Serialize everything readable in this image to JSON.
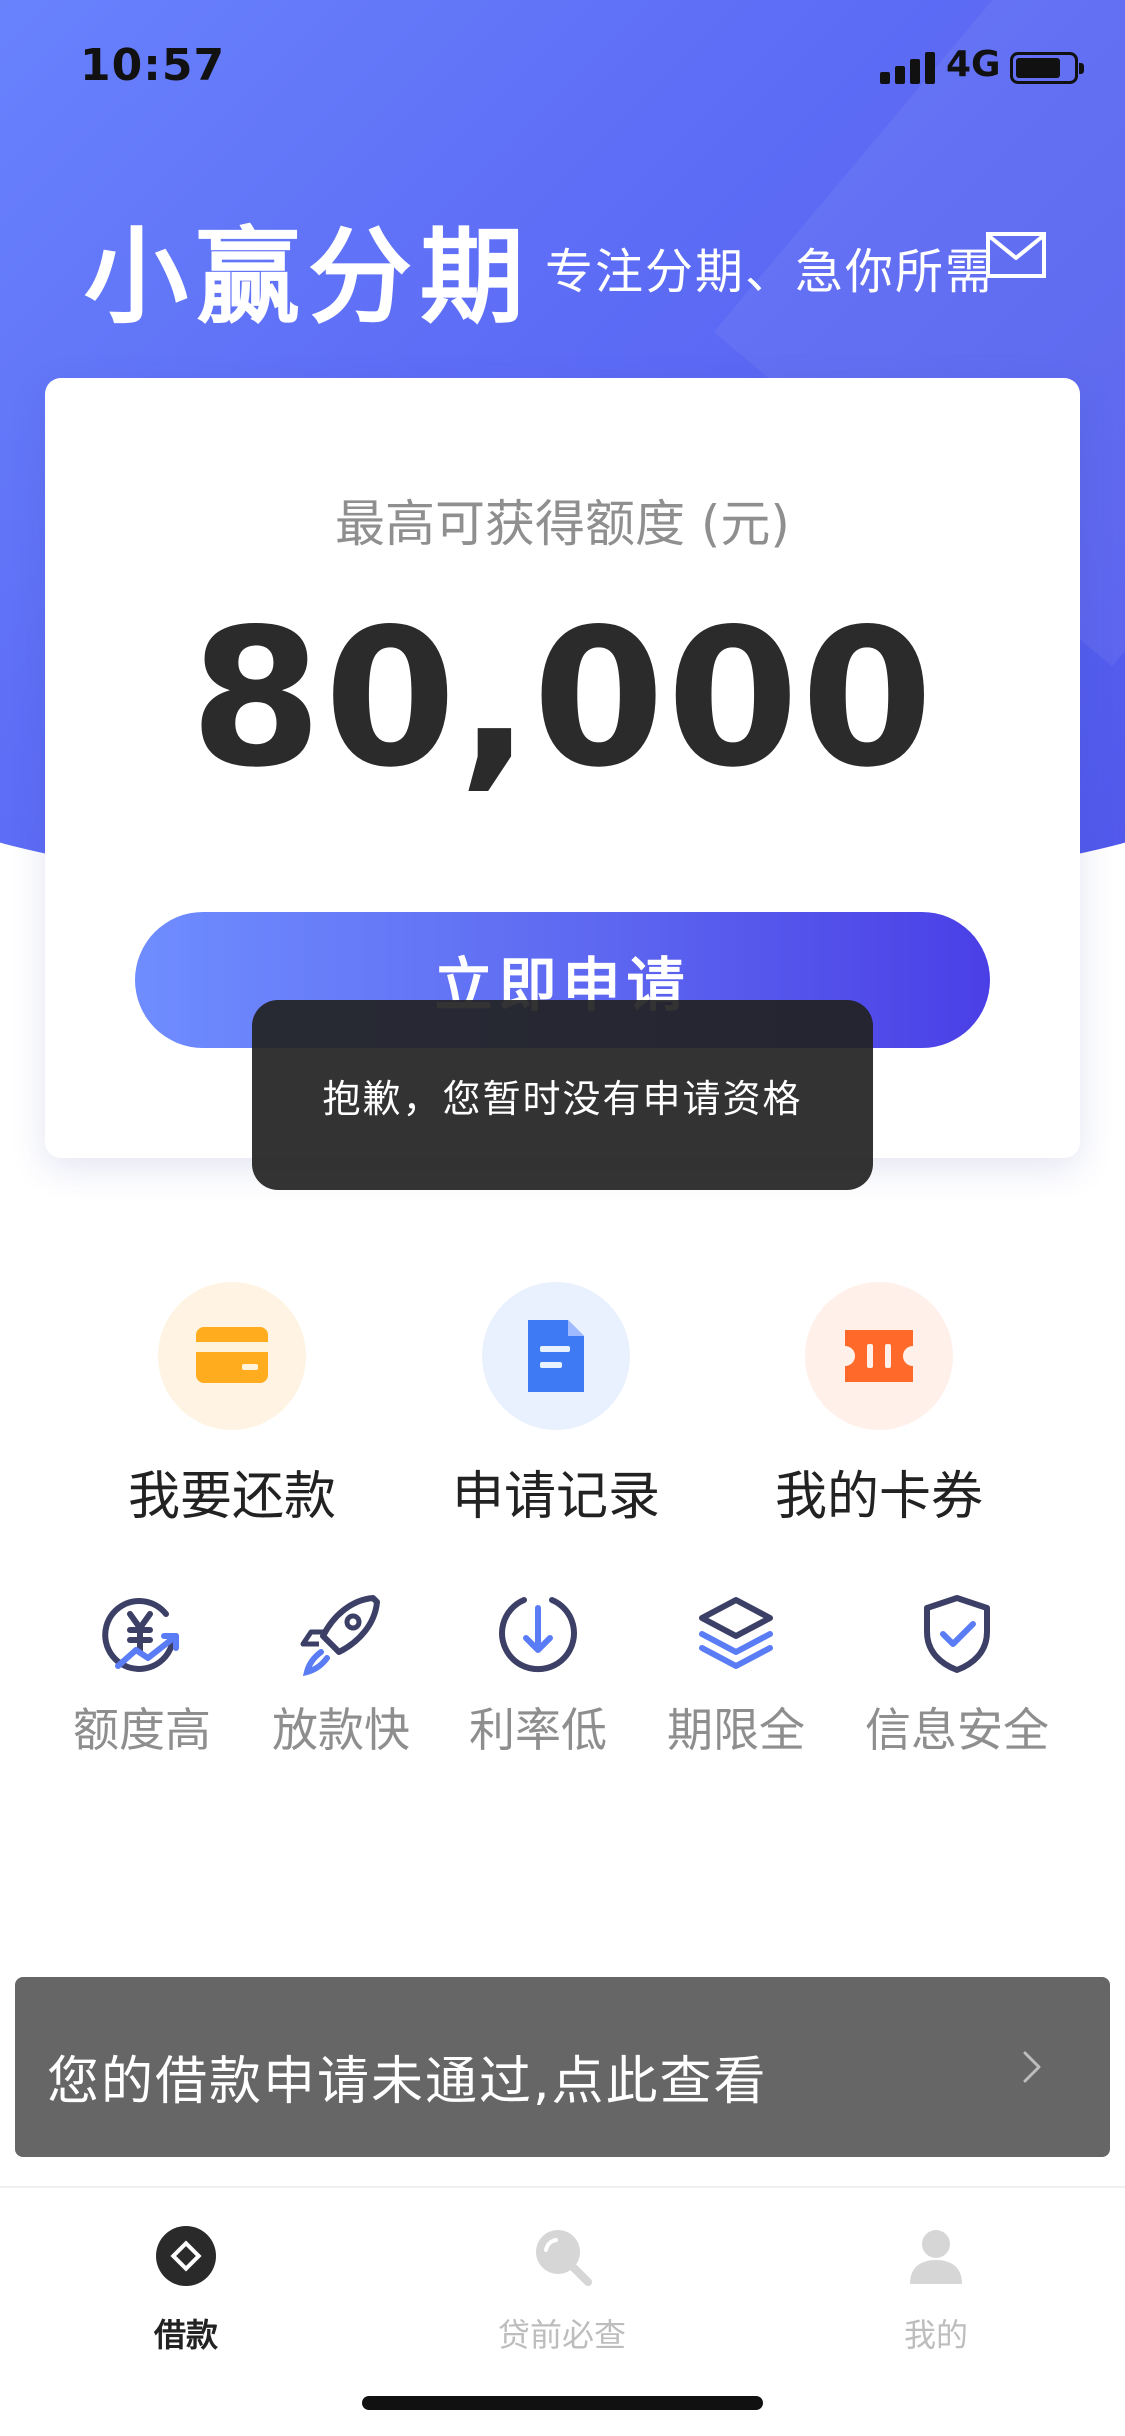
{
  "status_bar": {
    "time": "10:57",
    "network": "4G"
  },
  "header": {
    "title": "小赢分期",
    "slogan": "专注分期、急你所需"
  },
  "credit_card": {
    "label": "最高可获得额度 (元)",
    "amount": "80,000",
    "apply_button": "立即申请"
  },
  "toast": {
    "message": "抱歉，您暂时没有申请资格"
  },
  "quick_actions": [
    {
      "label": "我要还款",
      "icon": "card-icon",
      "bg": "#fff4e3",
      "color": "#ffad1f"
    },
    {
      "label": "申请记录",
      "icon": "document-icon",
      "bg": "#e9f1ff",
      "color": "#3f7af5"
    },
    {
      "label": "我的卡券",
      "icon": "ticket-icon",
      "bg": "#fff0ea",
      "color": "#ff6a2a"
    }
  ],
  "features": [
    {
      "label": "额度高",
      "icon": "yuan-growth-icon"
    },
    {
      "label": "放款快",
      "icon": "rocket-icon"
    },
    {
      "label": "利率低",
      "icon": "down-arrow-circle-icon"
    },
    {
      "label": "期限全",
      "icon": "layers-icon"
    },
    {
      "label": "信息安全",
      "icon": "shield-check-icon"
    }
  ],
  "notice": {
    "text": "您的借款申请未通过,点此查看"
  },
  "tabs": [
    {
      "label": "借款",
      "icon": "borrow-icon",
      "active": true
    },
    {
      "label": "贷前必查",
      "icon": "search-icon",
      "active": false
    },
    {
      "label": "我的",
      "icon": "user-icon",
      "active": false
    }
  ],
  "colors": {
    "accent": "#5e6ef6",
    "feature_icon": "#3c3f66",
    "feature_accent": "#5a7cf5"
  }
}
